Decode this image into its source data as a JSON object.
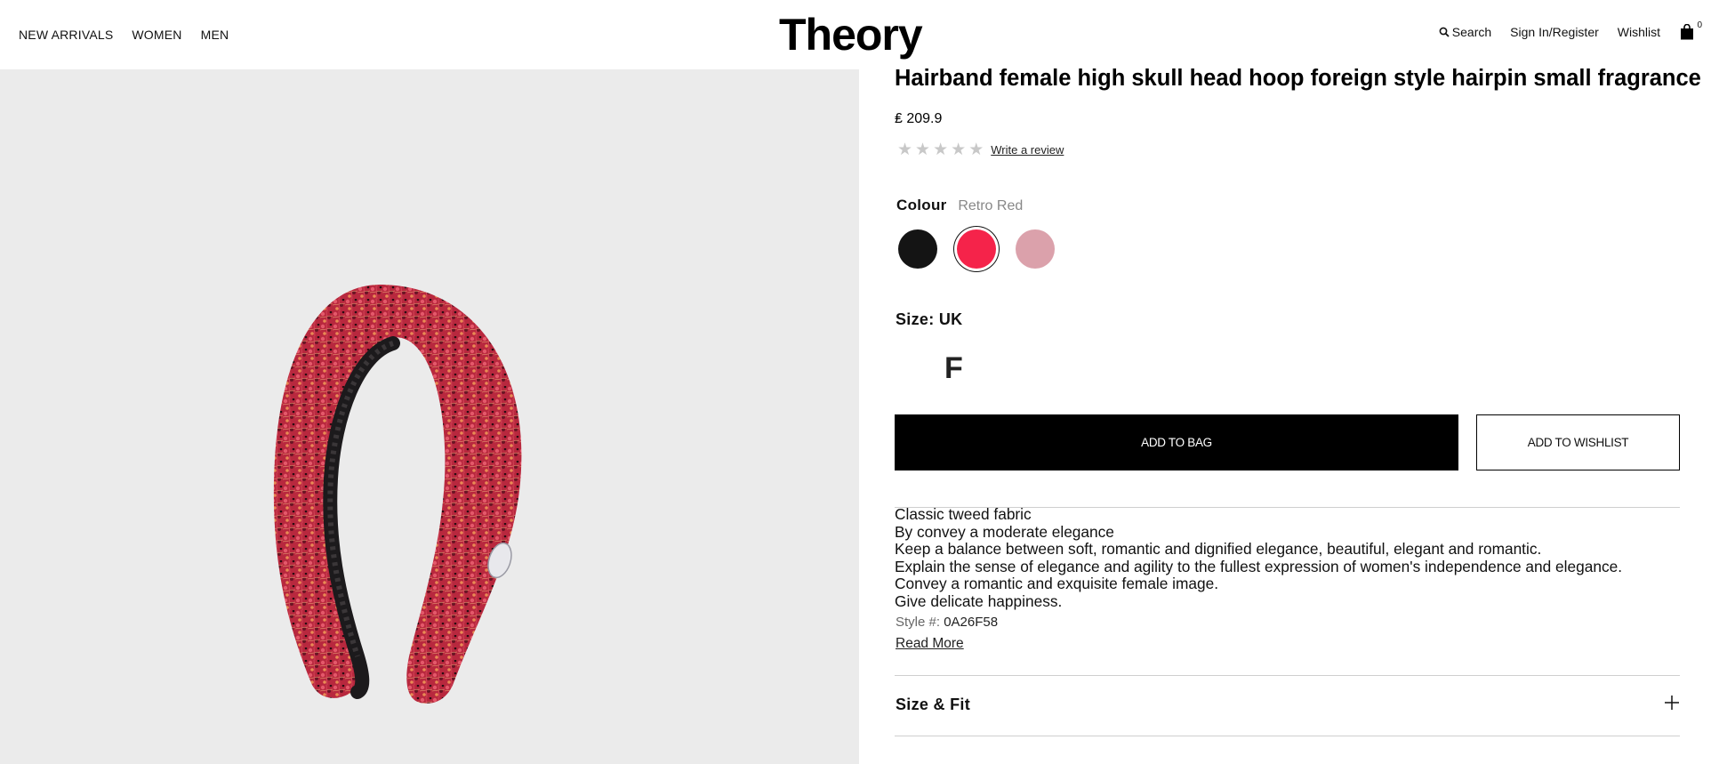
{
  "header": {
    "nav_left": [
      "NEW ARRIVALS",
      "WOMEN",
      "MEN"
    ],
    "logo": "Theory",
    "search_label": "Search",
    "signin_label": "Sign In/Register",
    "wishlist_label": "Wishlist",
    "bag_count": "0"
  },
  "product": {
    "title": "Hairband female high skull head hoop foreign style hairpin small fragrance",
    "price": "₤ 209.9",
    "rating_stars": 0,
    "rating_max": 5,
    "review_link": "Write a review",
    "colour_label": "Colour",
    "colour_value": "Retro Red",
    "swatches": [
      {
        "name": "Black",
        "hex": "#141414",
        "selected": false
      },
      {
        "name": "Retro Red",
        "hex": "#f5234a",
        "selected": true
      },
      {
        "name": "Pink",
        "hex": "#dba1ab",
        "selected": false
      }
    ],
    "size_label": "Size: UK",
    "size_option": "F",
    "add_to_bag": "ADD TO BAG",
    "add_to_wishlist": "ADD TO WISHLIST",
    "description": [
      "Classic tweed fabric",
      "By convey a moderate elegance",
      "Keep a balance between soft, romantic and dignified elegance, beautiful, elegant and romantic.",
      "Explain the sense of elegance and agility to the fullest expression of women's independence and elegance.",
      "Convey a romantic and exquisite female image.",
      "Give delicate happiness."
    ],
    "style_label": "Style #:",
    "style_number": "0A26F58",
    "read_more": "Read More",
    "accordion_size_fit": "Size & Fit"
  },
  "colors": {
    "image_bg": "#ebebeb",
    "button_black": "#000000",
    "divider": "#cfcfcf"
  }
}
